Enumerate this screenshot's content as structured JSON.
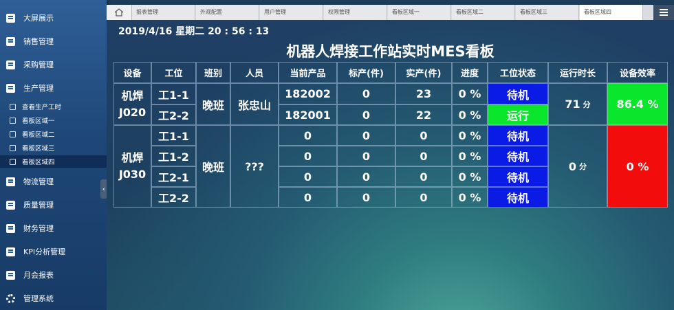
{
  "sidebar": {
    "items": [
      {
        "label": "大屏展示",
        "icon": "dashboard-icon"
      },
      {
        "label": "销售管理",
        "icon": "document-icon"
      },
      {
        "label": "采购管理",
        "icon": "document-icon"
      },
      {
        "label": "生产管理",
        "icon": "document-icon"
      },
      {
        "label": "物流管理",
        "icon": "document-icon"
      },
      {
        "label": "质量管理",
        "icon": "document-icon"
      },
      {
        "label": "财务管理",
        "icon": "document-icon"
      },
      {
        "label": "KPI分析管理",
        "icon": "document-icon"
      },
      {
        "label": "月会报表",
        "icon": "document-icon"
      },
      {
        "label": "管理系统",
        "icon": "gear-icon"
      }
    ],
    "subitems": [
      {
        "label": "查看生产工时",
        "icon": "bar-chart-icon"
      },
      {
        "label": "看板区域一",
        "icon": "board-icon"
      },
      {
        "label": "看板区域二",
        "icon": "board-icon"
      },
      {
        "label": "看板区域三",
        "icon": "board-icon"
      },
      {
        "label": "看板区域四",
        "icon": "board-icon",
        "active": true
      }
    ]
  },
  "tabs": [
    {
      "label": "报表管理"
    },
    {
      "label": "外观配置"
    },
    {
      "label": "用户管理"
    },
    {
      "label": "权限管理"
    },
    {
      "label": "看板区域一"
    },
    {
      "label": "看板区域二"
    },
    {
      "label": "看板区域三"
    },
    {
      "label": "看板区域四",
      "active": true
    }
  ],
  "board": {
    "datetime": "2019/4/16 星期二 20 : 56 : 13",
    "title": "机器人焊接工作站实时MES看板",
    "headers": [
      "设备",
      "工位",
      "班别",
      "人员",
      "当前产品",
      "标产(件)",
      "实产(件)",
      "进度",
      "工位状态",
      "运行时长",
      "设备效率"
    ],
    "groups": [
      {
        "device": "机焊\nJ020",
        "shift": "晚班",
        "person": "张忠山",
        "runtime_value": "71",
        "runtime_unit": "分",
        "efficiency": "86.4 %",
        "rows": [
          {
            "station": "工1-1",
            "product": "182002",
            "std": "0",
            "actual": "23",
            "progress": "0 %",
            "status": "待机"
          },
          {
            "station": "工2-2",
            "product": "182001",
            "std": "0",
            "actual": "22",
            "progress": "0 %",
            "status": "运行"
          }
        ]
      },
      {
        "device": "机焊\nJ030",
        "shift": "晚班",
        "person": "???",
        "runtime_value": "0",
        "runtime_unit": "分",
        "efficiency": "0 %",
        "rows": [
          {
            "station": "工1-1",
            "product": "0",
            "std": "0",
            "actual": "0",
            "progress": "0 %",
            "status": "待机"
          },
          {
            "station": "工1-2",
            "product": "0",
            "std": "0",
            "actual": "0",
            "progress": "0 %",
            "status": "待机"
          },
          {
            "station": "工2-1",
            "product": "0",
            "std": "0",
            "actual": "0",
            "progress": "0 %",
            "status": "待机"
          },
          {
            "station": "工2-2",
            "product": "0",
            "std": "0",
            "actual": "0",
            "progress": "0 %",
            "status": "待机"
          }
        ]
      }
    ]
  },
  "colors": {
    "status_wait": "#0b1be6",
    "status_run": "#09e62c",
    "efficiency_good": "#09e62c",
    "efficiency_bad": "#f20c0c"
  }
}
